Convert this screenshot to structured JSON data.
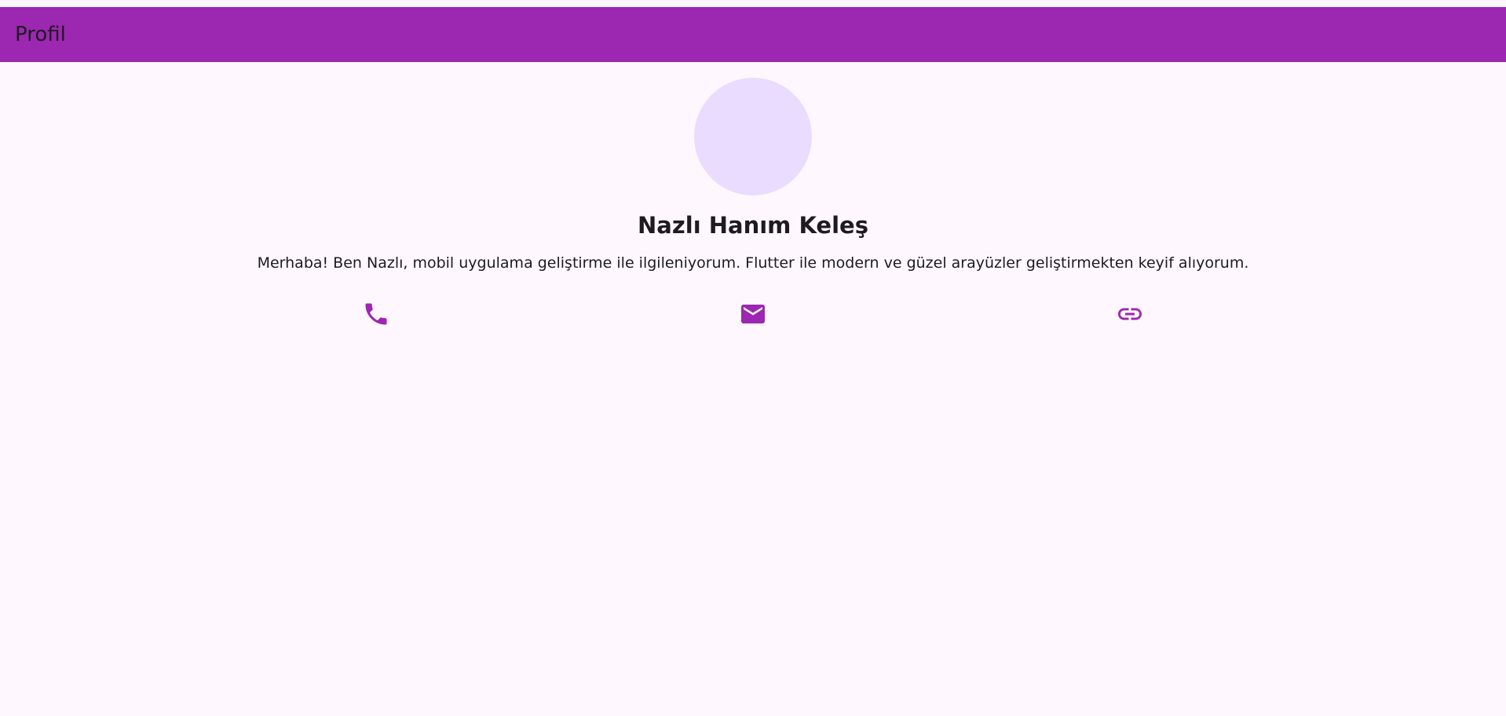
{
  "app_bar": {
    "title": "Profil",
    "background": "#9c27b0"
  },
  "profile": {
    "avatar_color": "#eadcff",
    "name": "Nazlı Hanım Keleş",
    "bio": "Merhaba! Ben Nazlı, mobil uygulama geliştirme ile ilgileniyorum. Flutter ile modern ve güzel arayüzler geliştirmekten keyif alıyorum."
  },
  "contacts": [
    {
      "icon": "phone-icon"
    },
    {
      "icon": "email-icon"
    },
    {
      "icon": "link-icon"
    }
  ],
  "colors": {
    "accent": "#9c27b0",
    "background": "#fff7fe",
    "text": "#1d1b20"
  }
}
